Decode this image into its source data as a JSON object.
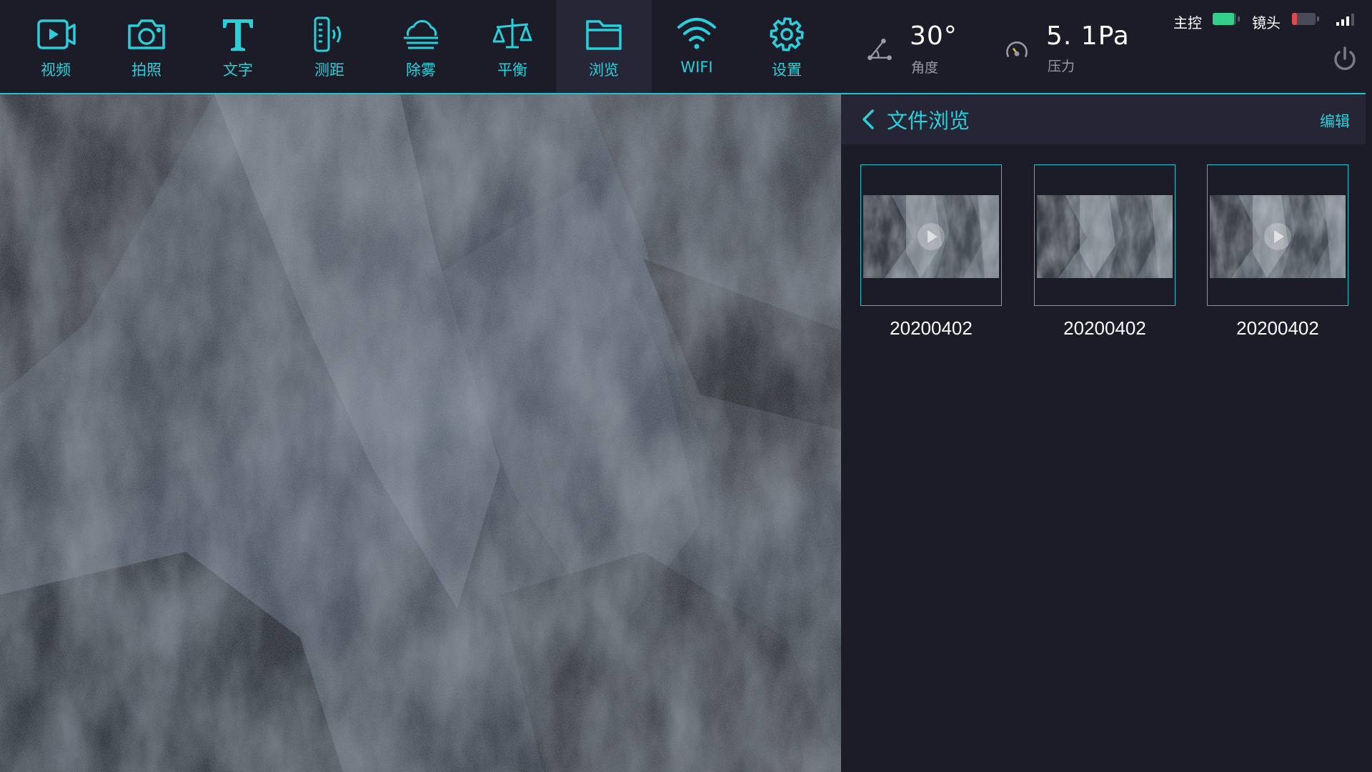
{
  "toolbar": {
    "items": [
      {
        "label": "视频",
        "icon": "video-icon"
      },
      {
        "label": "拍照",
        "icon": "camera-icon"
      },
      {
        "label": "文字",
        "icon": "text-icon"
      },
      {
        "label": "测距",
        "icon": "distance-icon"
      },
      {
        "label": "除雾",
        "icon": "defog-icon"
      },
      {
        "label": "平衡",
        "icon": "balance-icon"
      },
      {
        "label": "浏览",
        "icon": "folder-icon",
        "active": true
      },
      {
        "label": "WIFI",
        "icon": "wifi-icon"
      },
      {
        "label": "设置",
        "icon": "gear-icon"
      }
    ]
  },
  "readouts": {
    "angle": {
      "value": "30°",
      "label": "角度"
    },
    "pressure": {
      "value": "5. 1Pa",
      "label": "压力"
    }
  },
  "status": {
    "main": {
      "label": "主控",
      "battery_level": 0.9,
      "color": "#33d08a"
    },
    "lens": {
      "label": "镜头",
      "battery_level": 0.2,
      "color": "#e04a4a"
    },
    "signal_bars": 3
  },
  "panel": {
    "title": "文件浏览",
    "edit_label": "编辑",
    "files": [
      {
        "name": "20200402",
        "has_play": true
      },
      {
        "name": "20200402",
        "has_play": false
      },
      {
        "name": "20200402",
        "has_play": true
      }
    ]
  },
  "colors": {
    "accent": "#28d0db",
    "background": "#1c1b28",
    "header": "#262535"
  }
}
